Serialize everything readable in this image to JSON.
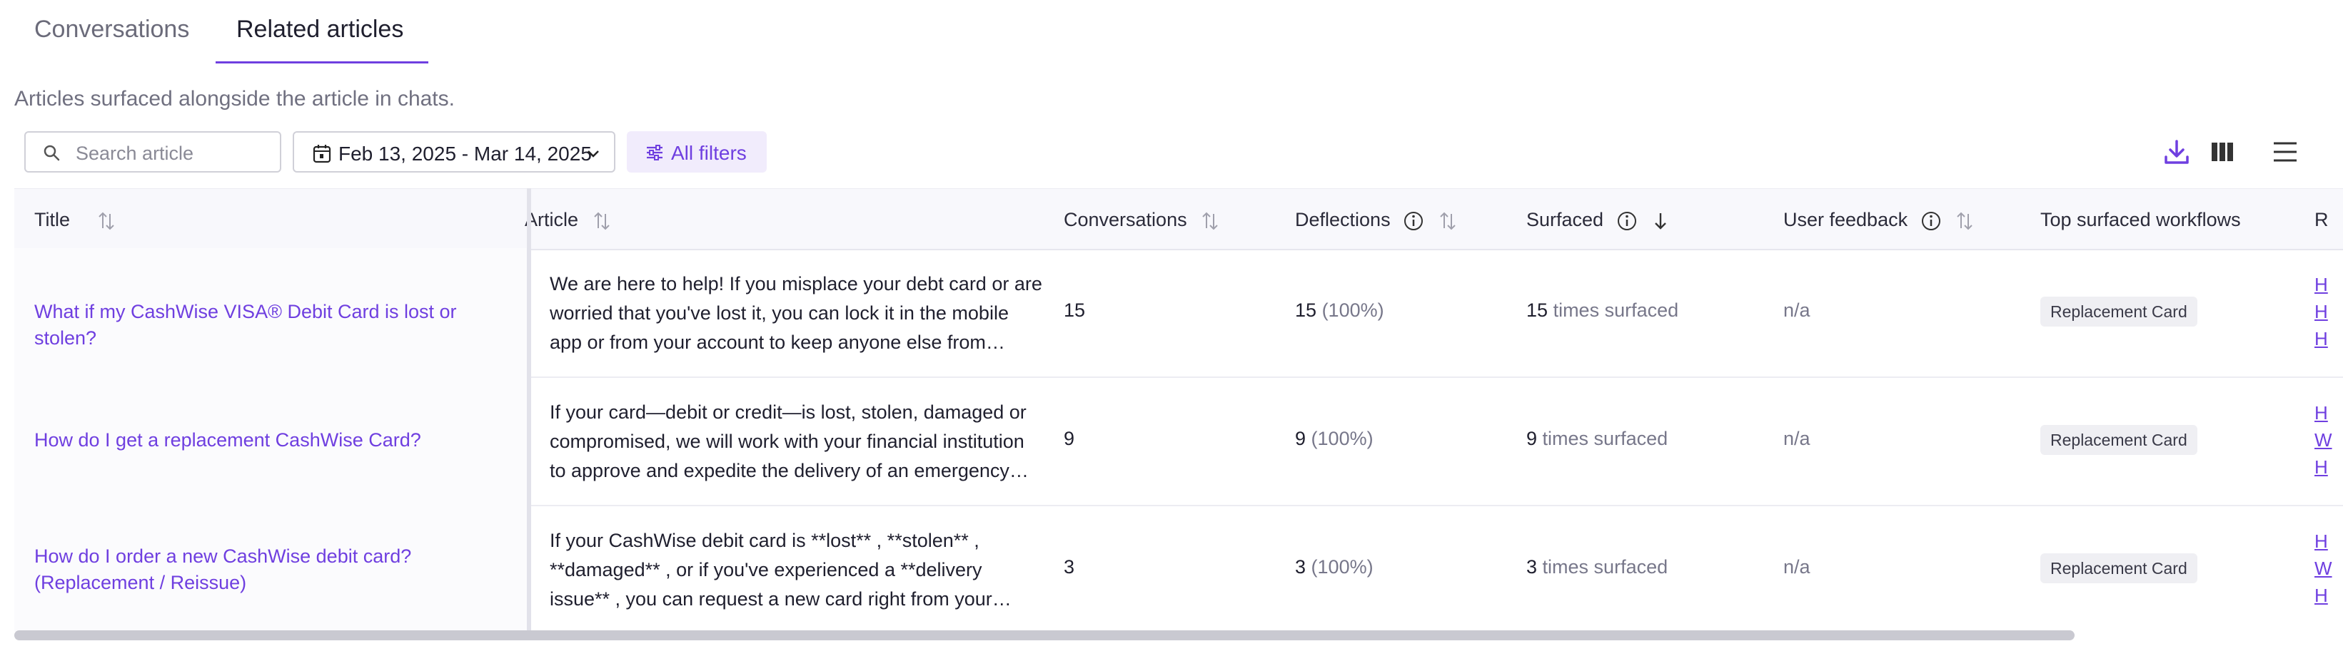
{
  "tabs": [
    {
      "label": "Conversations",
      "active": false
    },
    {
      "label": "Related articles",
      "active": true
    }
  ],
  "subtitle": "Articles surfaced alongside the article in chats.",
  "toolbar": {
    "search_placeholder": "Search article",
    "date_range": "Feb 13, 2025 - Mar 14, 2025",
    "filters_label": "All filters",
    "icons": [
      "download-icon",
      "columns-icon",
      "density-icon"
    ]
  },
  "table": {
    "columns": [
      "Title",
      "Article",
      "Conversations",
      "Deflections",
      "Surfaced",
      "User feedback",
      "Top surfaced workflows",
      "R"
    ],
    "rows": [
      {
        "title": "What if my CashWise VISA® Debit Card is lost or stolen?",
        "article": "We are here to help! If you misplace your debt card or are worried that you've lost it, you can lock it in the mobile app or from your account to keep anyone else from…",
        "conversations": "15",
        "deflections": "15",
        "deflections_pct": "(100%)",
        "surfaced": "15",
        "surfaced_suffix": "times surfaced",
        "feedback": "n/a",
        "workflow": "Replacement Card",
        "links": [
          "H",
          "H",
          "H"
        ]
      },
      {
        "title": "How do I get a replacement CashWise Card?",
        "article": "If your card—debit or credit—is lost, stolen, damaged or compromised, we will work with your financial institution to approve and expedite the delivery of an emergency…",
        "conversations": "9",
        "deflections": "9",
        "deflections_pct": "(100%)",
        "surfaced": "9",
        "surfaced_suffix": "times surfaced",
        "feedback": "n/a",
        "workflow": "Replacement Card",
        "links": [
          "H",
          "W",
          "H"
        ]
      },
      {
        "title": "How do I order a new CashWise debit card? (Replacement / Reissue)",
        "article": "If your CashWise debit card is **lost** , **stolen** , **damaged** , or if you've experienced a **delivery issue** , you can request a new card right from your…",
        "conversations": "3",
        "deflections": "3",
        "deflections_pct": "(100%)",
        "surfaced": "3",
        "surfaced_suffix": "times surfaced",
        "feedback": "n/a",
        "workflow": "Replacement Card",
        "links": [
          "H",
          "W",
          "H"
        ]
      }
    ]
  },
  "colors": {
    "accent": "#6f3fe0",
    "pill_bg": "#efeff3"
  }
}
